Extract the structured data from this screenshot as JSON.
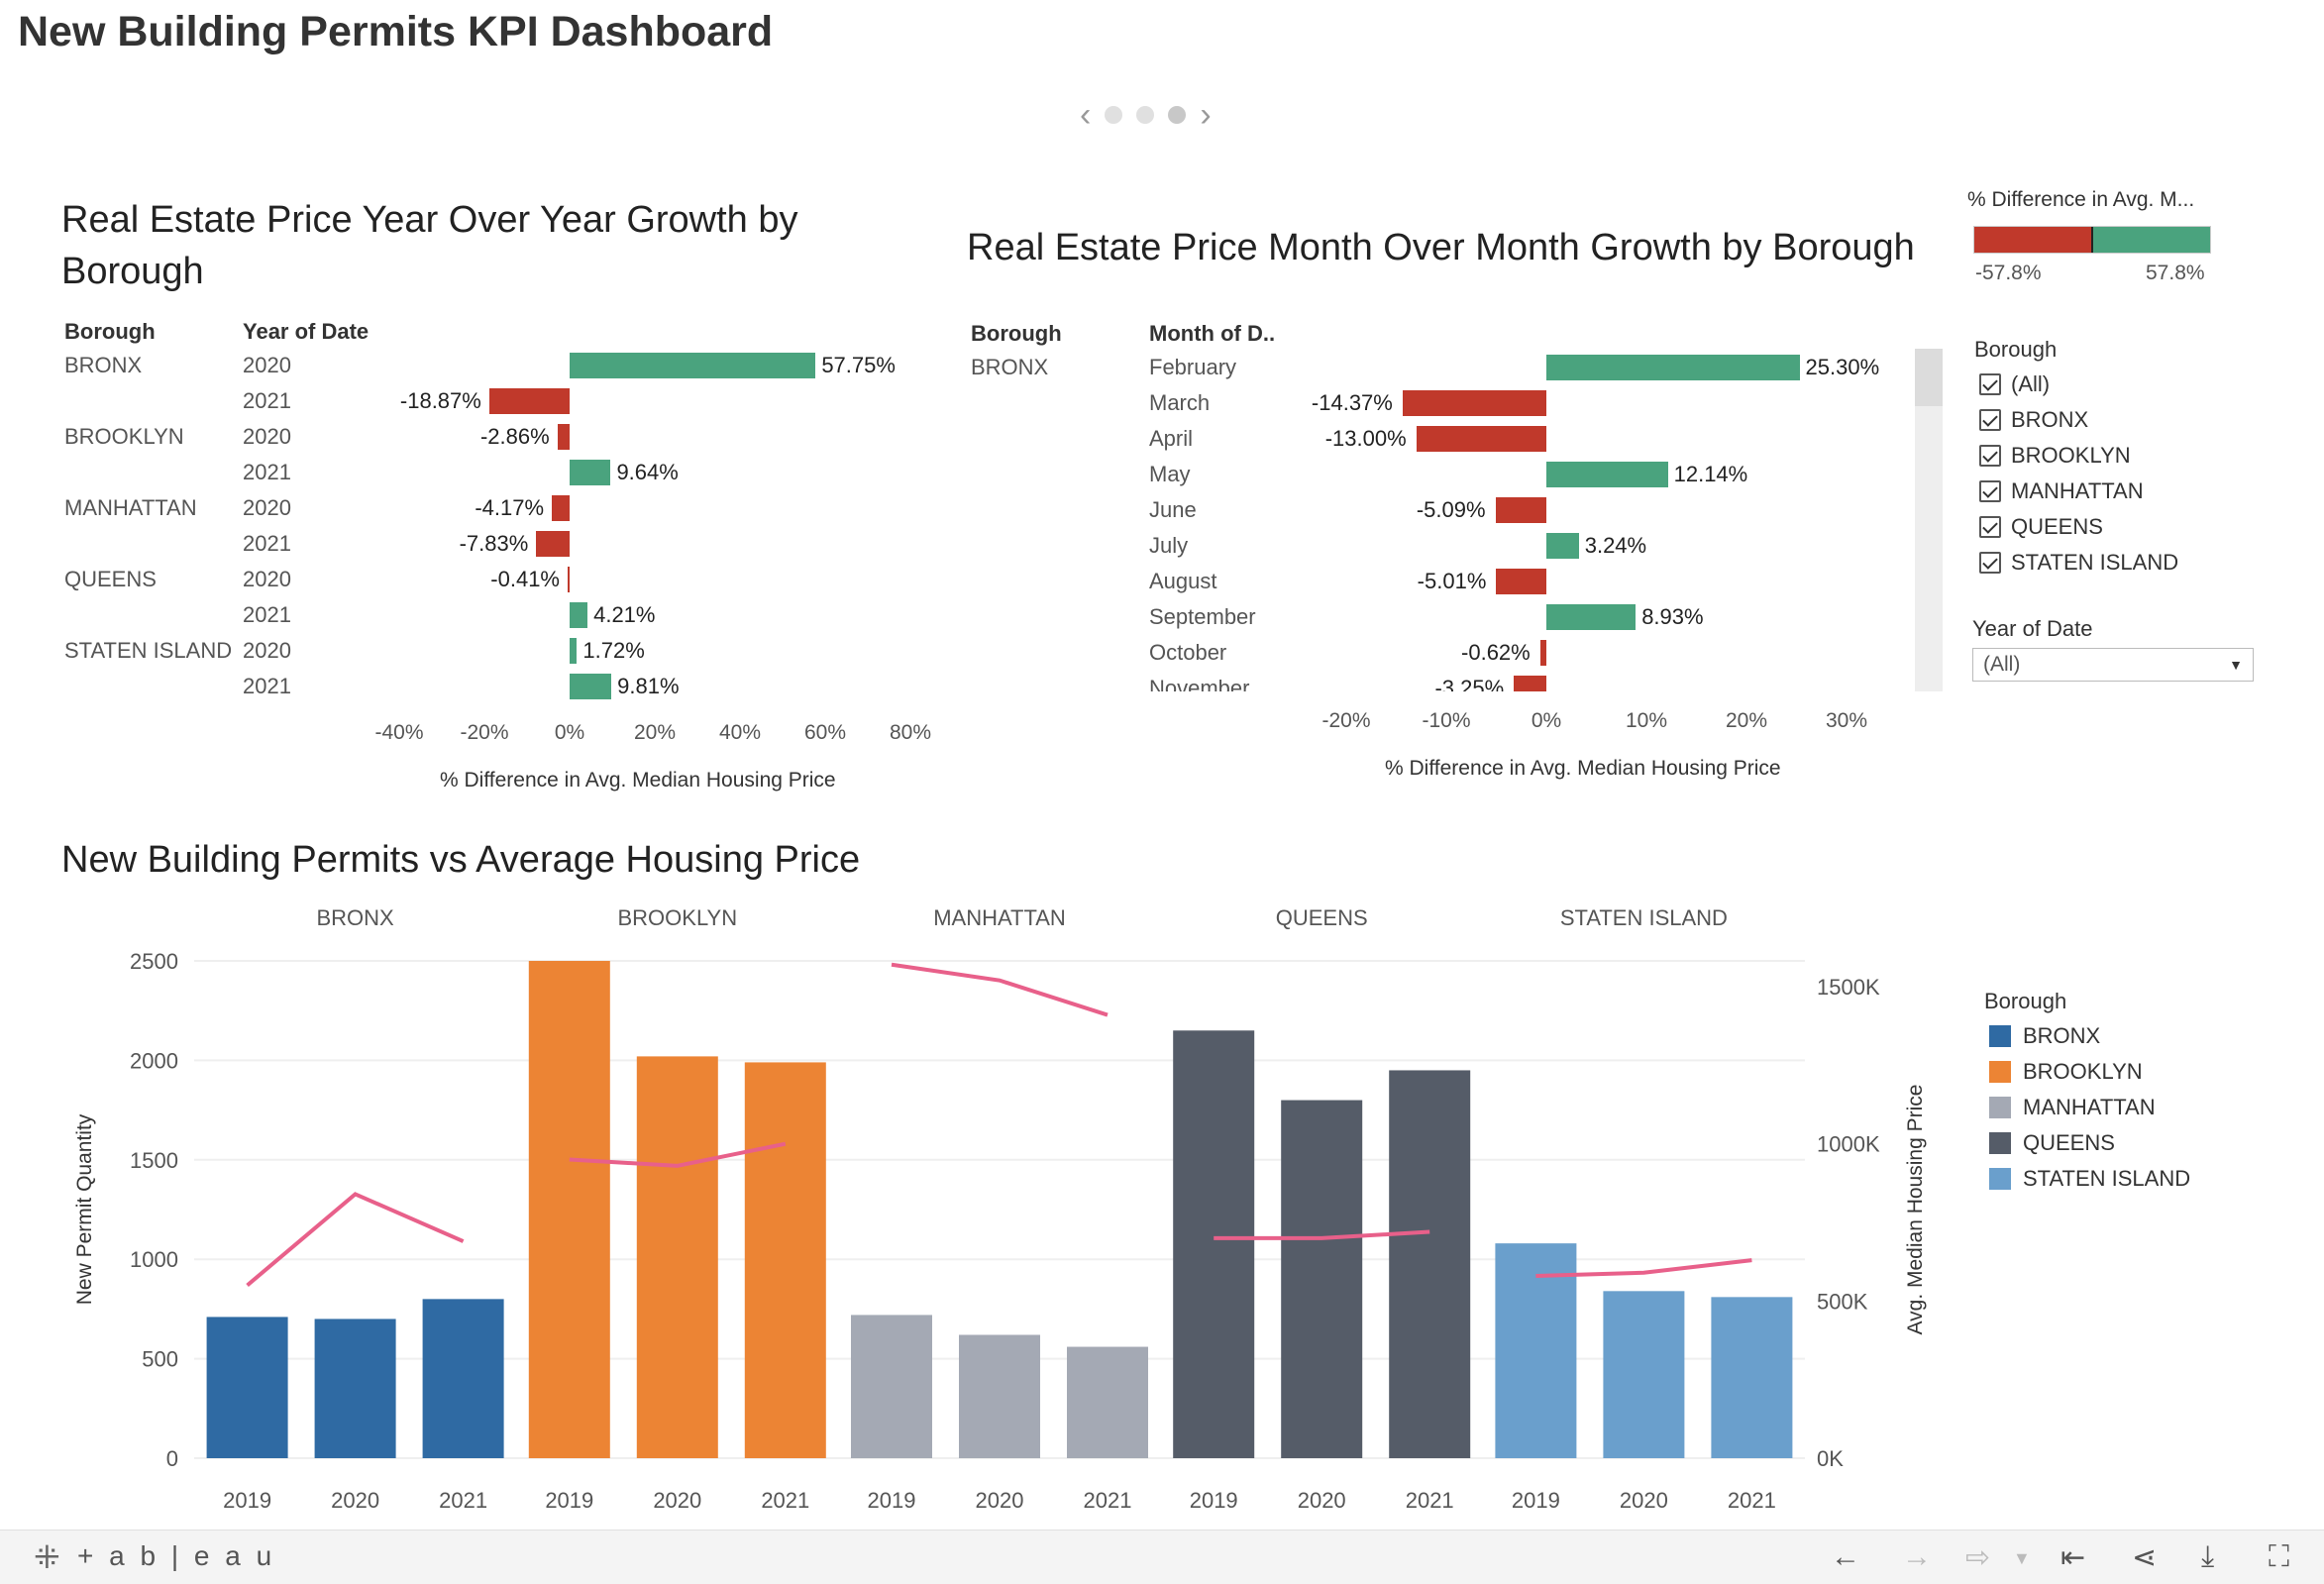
{
  "page_title": "New Building Permits KPI Dashboard",
  "yoy": {
    "title": "Real Estate Price Year Over Year Growth by Borough",
    "col_borough": "Borough",
    "col_year": "Year of Date",
    "rows": [
      {
        "borough": "BRONX",
        "year": "2020",
        "value": 57.75,
        "label": "57.75%"
      },
      {
        "borough": "",
        "year": "2021",
        "value": -18.87,
        "label": "-18.87%"
      },
      {
        "borough": "BROOKLYN",
        "year": "2020",
        "value": -2.86,
        "label": "-2.86%"
      },
      {
        "borough": "",
        "year": "2021",
        "value": 9.64,
        "label": "9.64%"
      },
      {
        "borough": "MANHATTAN",
        "year": "2020",
        "value": -4.17,
        "label": "-4.17%"
      },
      {
        "borough": "",
        "year": "2021",
        "value": -7.83,
        "label": "-7.83%"
      },
      {
        "borough": "QUEENS",
        "year": "2020",
        "value": -0.41,
        "label": "-0.41%"
      },
      {
        "borough": "",
        "year": "2021",
        "value": 4.21,
        "label": "4.21%"
      },
      {
        "borough": "STATEN ISLAND",
        "year": "2020",
        "value": 1.72,
        "label": "1.72%"
      },
      {
        "borough": "",
        "year": "2021",
        "value": 9.81,
        "label": "9.81%"
      }
    ],
    "ticks": [
      "-40%",
      "-20%",
      "0%",
      "20%",
      "40%",
      "60%",
      "80%"
    ],
    "xlabel": "% Difference in Avg. Median Housing Price"
  },
  "mom": {
    "title": "Real Estate Price Month Over Month Growth by Borough",
    "col_borough": "Borough",
    "col_month": "Month of D..",
    "borough": "BRONX",
    "rows": [
      {
        "month": "February",
        "value": 25.3,
        "label": "25.30%"
      },
      {
        "month": "March",
        "value": -14.37,
        "label": "-14.37%"
      },
      {
        "month": "April",
        "value": -13.0,
        "label": "-13.00%"
      },
      {
        "month": "May",
        "value": 12.14,
        "label": "12.14%"
      },
      {
        "month": "June",
        "value": -5.09,
        "label": "-5.09%"
      },
      {
        "month": "July",
        "value": 3.24,
        "label": "3.24%"
      },
      {
        "month": "August",
        "value": -5.01,
        "label": "-5.01%"
      },
      {
        "month": "September",
        "value": 8.93,
        "label": "8.93%"
      },
      {
        "month": "October",
        "value": -0.62,
        "label": "-0.62%"
      },
      {
        "month": "November",
        "value": -3.25,
        "label": "-3.25%"
      }
    ],
    "ticks": [
      "-20%",
      "-10%",
      "0%",
      "10%",
      "20%",
      "30%"
    ],
    "xlabel": "% Difference in Avg. Median Housing Price"
  },
  "color_legend": {
    "title": "% Difference in Avg. M...",
    "min_label": "-57.8%",
    "max_label": "57.8%",
    "neg_color": "#c0392b",
    "pos_color": "#4aa37e"
  },
  "borough_filter": {
    "title": "Borough",
    "items": [
      "(All)",
      "BRONX",
      "BROOKLYN",
      "MANHATTAN",
      "QUEENS",
      "STATEN ISLAND"
    ]
  },
  "year_filter": {
    "title": "Year of Date",
    "value": "(All)"
  },
  "permits": {
    "title": "New Building Permits vs Average Housing Price",
    "ylabel_left": "New Permit Quantity",
    "ylabel_right": "Avg. Median Housing Price",
    "left_ticks": [
      "2500",
      "2000",
      "1500",
      "1000",
      "500",
      "0"
    ],
    "right_ticks": [
      "1500K",
      "1000K",
      "500K",
      "0K"
    ],
    "legend_title": "Borough",
    "legend": [
      {
        "name": "BRONX",
        "color": "#2f6aa3"
      },
      {
        "name": "BROOKLYN",
        "color": "#ec8434"
      },
      {
        "name": "MANHATTAN",
        "color": "#a4a9b4"
      },
      {
        "name": "QUEENS",
        "color": "#555c68"
      },
      {
        "name": "STATEN ISLAND",
        "color": "#6a9fcc"
      }
    ],
    "line_color": "#e8608a"
  },
  "chart_data": {
    "type": "bar",
    "title": "New Building Permits vs Average Housing Price",
    "ylabel": "New Permit Quantity",
    "ylabel_secondary": "Avg. Median Housing Price",
    "ylim": [
      0,
      2500
    ],
    "ylim_secondary": [
      0,
      1500000
    ],
    "groups": [
      "BRONX",
      "BROOKLYN",
      "MANHATTAN",
      "QUEENS",
      "STATEN ISLAND"
    ],
    "categories": [
      "2019",
      "2020",
      "2021"
    ],
    "series": [
      {
        "name": "BRONX",
        "values": [
          710,
          700,
          800
        ],
        "price": [
          550000,
          840000,
          690000
        ]
      },
      {
        "name": "BROOKLYN",
        "values": [
          2500,
          2020,
          1990
        ],
        "price": [
          950000,
          930000,
          1000000
        ]
      },
      {
        "name": "MANHATTAN",
        "values": [
          720,
          620,
          560
        ],
        "price": [
          1570000,
          1520000,
          1410000
        ]
      },
      {
        "name": "QUEENS",
        "values": [
          2150,
          1800,
          1950
        ],
        "price": [
          700000,
          700000,
          720000
        ]
      },
      {
        "name": "STATEN ISLAND",
        "values": [
          1080,
          840,
          810
        ],
        "price": [
          580000,
          590000,
          630000
        ]
      }
    ]
  },
  "toolbar": {
    "logo": "+ a b | e a u"
  }
}
